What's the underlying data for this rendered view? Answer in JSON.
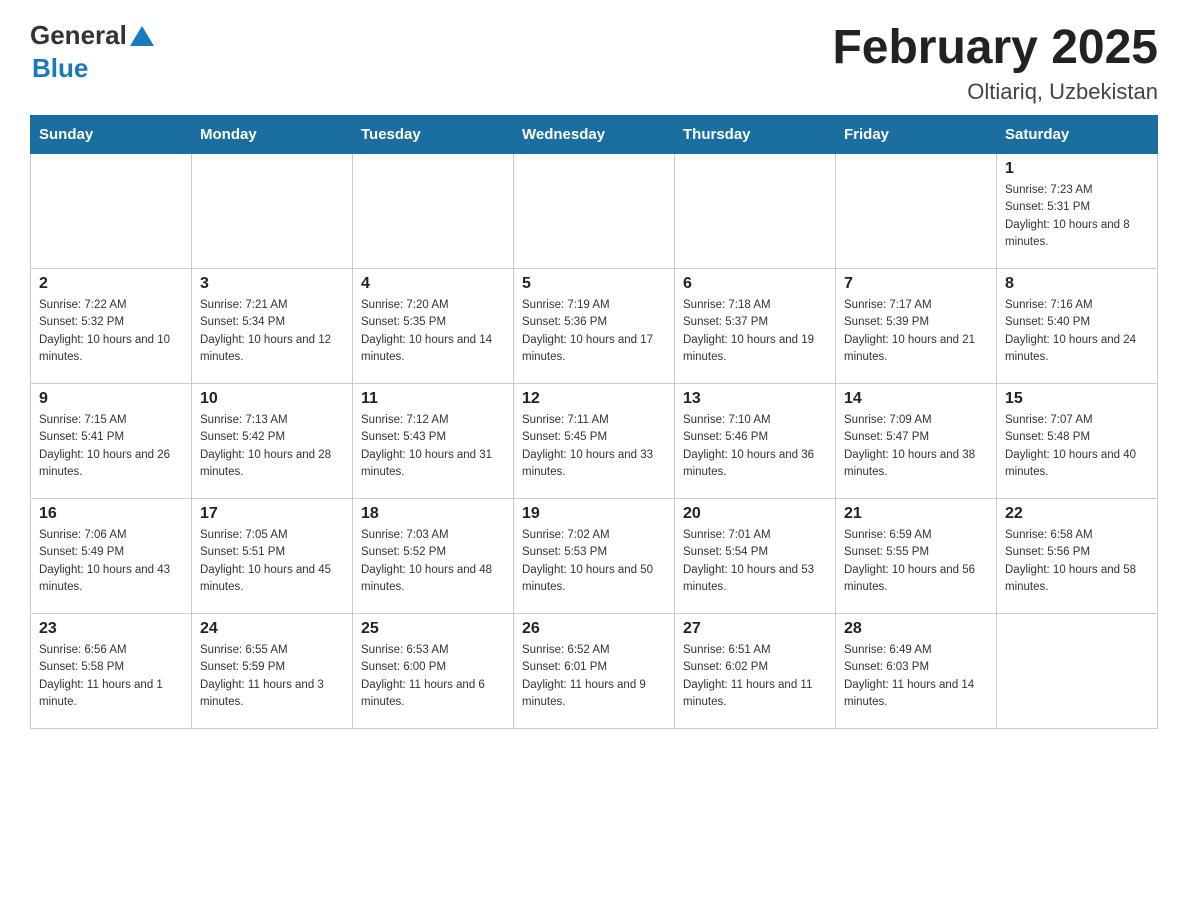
{
  "header": {
    "logo_general": "General",
    "logo_blue": "Blue",
    "title": "February 2025",
    "subtitle": "Oltiariq, Uzbekistan"
  },
  "weekdays": [
    "Sunday",
    "Monday",
    "Tuesday",
    "Wednesday",
    "Thursday",
    "Friday",
    "Saturday"
  ],
  "weeks": [
    {
      "days": [
        {
          "num": "",
          "info": ""
        },
        {
          "num": "",
          "info": ""
        },
        {
          "num": "",
          "info": ""
        },
        {
          "num": "",
          "info": ""
        },
        {
          "num": "",
          "info": ""
        },
        {
          "num": "",
          "info": ""
        },
        {
          "num": "1",
          "info": "Sunrise: 7:23 AM\nSunset: 5:31 PM\nDaylight: 10 hours and 8 minutes."
        }
      ]
    },
    {
      "days": [
        {
          "num": "2",
          "info": "Sunrise: 7:22 AM\nSunset: 5:32 PM\nDaylight: 10 hours and 10 minutes."
        },
        {
          "num": "3",
          "info": "Sunrise: 7:21 AM\nSunset: 5:34 PM\nDaylight: 10 hours and 12 minutes."
        },
        {
          "num": "4",
          "info": "Sunrise: 7:20 AM\nSunset: 5:35 PM\nDaylight: 10 hours and 14 minutes."
        },
        {
          "num": "5",
          "info": "Sunrise: 7:19 AM\nSunset: 5:36 PM\nDaylight: 10 hours and 17 minutes."
        },
        {
          "num": "6",
          "info": "Sunrise: 7:18 AM\nSunset: 5:37 PM\nDaylight: 10 hours and 19 minutes."
        },
        {
          "num": "7",
          "info": "Sunrise: 7:17 AM\nSunset: 5:39 PM\nDaylight: 10 hours and 21 minutes."
        },
        {
          "num": "8",
          "info": "Sunrise: 7:16 AM\nSunset: 5:40 PM\nDaylight: 10 hours and 24 minutes."
        }
      ]
    },
    {
      "days": [
        {
          "num": "9",
          "info": "Sunrise: 7:15 AM\nSunset: 5:41 PM\nDaylight: 10 hours and 26 minutes."
        },
        {
          "num": "10",
          "info": "Sunrise: 7:13 AM\nSunset: 5:42 PM\nDaylight: 10 hours and 28 minutes."
        },
        {
          "num": "11",
          "info": "Sunrise: 7:12 AM\nSunset: 5:43 PM\nDaylight: 10 hours and 31 minutes."
        },
        {
          "num": "12",
          "info": "Sunrise: 7:11 AM\nSunset: 5:45 PM\nDaylight: 10 hours and 33 minutes."
        },
        {
          "num": "13",
          "info": "Sunrise: 7:10 AM\nSunset: 5:46 PM\nDaylight: 10 hours and 36 minutes."
        },
        {
          "num": "14",
          "info": "Sunrise: 7:09 AM\nSunset: 5:47 PM\nDaylight: 10 hours and 38 minutes."
        },
        {
          "num": "15",
          "info": "Sunrise: 7:07 AM\nSunset: 5:48 PM\nDaylight: 10 hours and 40 minutes."
        }
      ]
    },
    {
      "days": [
        {
          "num": "16",
          "info": "Sunrise: 7:06 AM\nSunset: 5:49 PM\nDaylight: 10 hours and 43 minutes."
        },
        {
          "num": "17",
          "info": "Sunrise: 7:05 AM\nSunset: 5:51 PM\nDaylight: 10 hours and 45 minutes."
        },
        {
          "num": "18",
          "info": "Sunrise: 7:03 AM\nSunset: 5:52 PM\nDaylight: 10 hours and 48 minutes."
        },
        {
          "num": "19",
          "info": "Sunrise: 7:02 AM\nSunset: 5:53 PM\nDaylight: 10 hours and 50 minutes."
        },
        {
          "num": "20",
          "info": "Sunrise: 7:01 AM\nSunset: 5:54 PM\nDaylight: 10 hours and 53 minutes."
        },
        {
          "num": "21",
          "info": "Sunrise: 6:59 AM\nSunset: 5:55 PM\nDaylight: 10 hours and 56 minutes."
        },
        {
          "num": "22",
          "info": "Sunrise: 6:58 AM\nSunset: 5:56 PM\nDaylight: 10 hours and 58 minutes."
        }
      ]
    },
    {
      "days": [
        {
          "num": "23",
          "info": "Sunrise: 6:56 AM\nSunset: 5:58 PM\nDaylight: 11 hours and 1 minute."
        },
        {
          "num": "24",
          "info": "Sunrise: 6:55 AM\nSunset: 5:59 PM\nDaylight: 11 hours and 3 minutes."
        },
        {
          "num": "25",
          "info": "Sunrise: 6:53 AM\nSunset: 6:00 PM\nDaylight: 11 hours and 6 minutes."
        },
        {
          "num": "26",
          "info": "Sunrise: 6:52 AM\nSunset: 6:01 PM\nDaylight: 11 hours and 9 minutes."
        },
        {
          "num": "27",
          "info": "Sunrise: 6:51 AM\nSunset: 6:02 PM\nDaylight: 11 hours and 11 minutes."
        },
        {
          "num": "28",
          "info": "Sunrise: 6:49 AM\nSunset: 6:03 PM\nDaylight: 11 hours and 14 minutes."
        },
        {
          "num": "",
          "info": ""
        }
      ]
    }
  ]
}
